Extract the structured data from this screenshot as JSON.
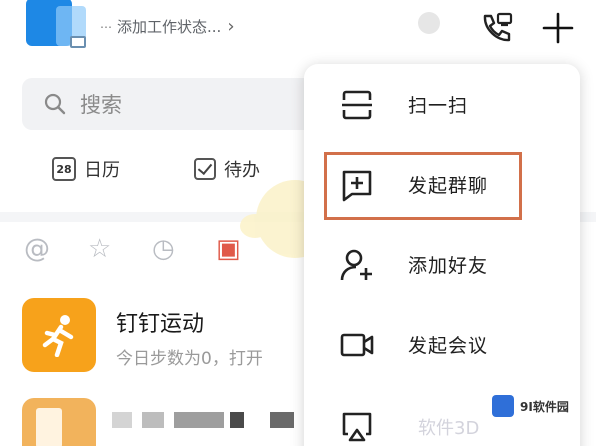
{
  "header": {
    "status_text": "添加工作状态...",
    "status_dots": "⋯",
    "chevron": "›"
  },
  "search": {
    "placeholder": "搜索"
  },
  "shortcuts": [
    {
      "label": "日历",
      "icon_text": "28"
    },
    {
      "label": "待办"
    }
  ],
  "filters": {
    "at": "@",
    "star": "☆",
    "clock": "◷",
    "memo": "▣"
  },
  "chats": [
    {
      "title": "钉钉运动",
      "subtitle": "今日步数为0，打开"
    }
  ],
  "menu": {
    "items": [
      {
        "label": "扫一扫",
        "icon": "scan-icon"
      },
      {
        "label": "发起群聊",
        "icon": "group-chat-plus-icon"
      },
      {
        "label": "添加好友",
        "icon": "add-friend-icon"
      },
      {
        "label": "发起会议",
        "icon": "video-meeting-icon"
      },
      {
        "label": "",
        "icon": "screen-cast-icon"
      }
    ],
    "highlighted_index": 1
  },
  "watermark": {
    "brand": "9I软件园",
    "faint": "软件3D"
  },
  "colors": {
    "accent_blue": "#1e88e5",
    "sport_orange": "#f7a21b",
    "highlight_border": "#d2704a"
  }
}
